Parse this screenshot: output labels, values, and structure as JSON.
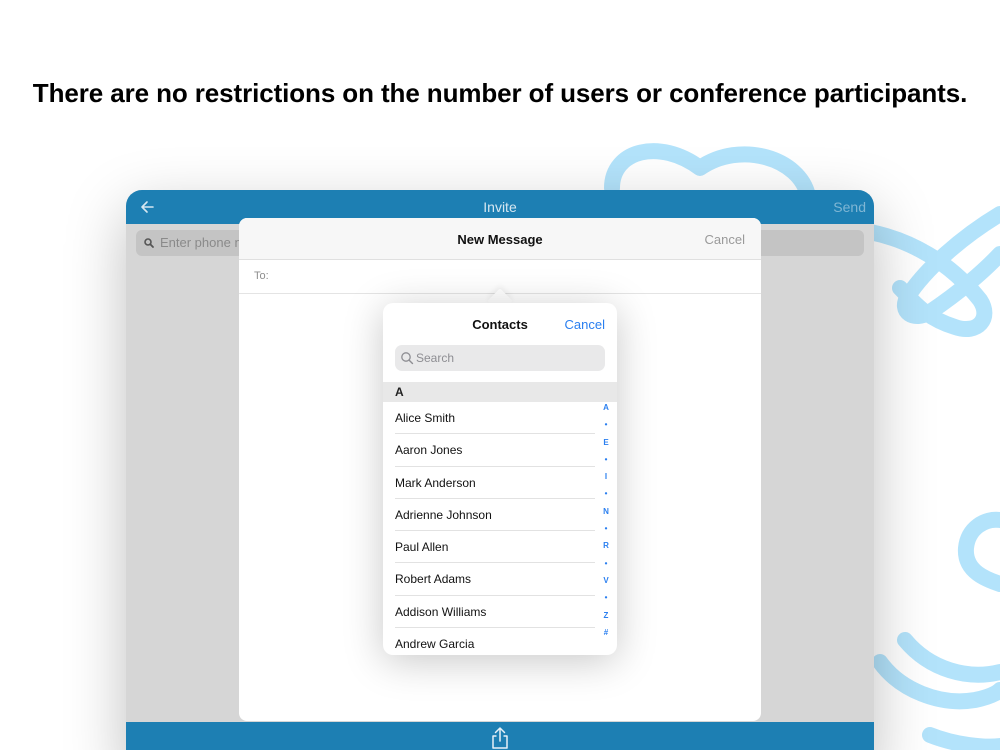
{
  "headline": "There are no restrictions on the number of users or conference participants.",
  "app": {
    "title": "Invite",
    "send_label": "Send",
    "search_placeholder": "Enter phone nu"
  },
  "message_sheet": {
    "title": "New Message",
    "cancel_label": "Cancel",
    "to_label": "To:"
  },
  "contacts_popover": {
    "title": "Contacts",
    "cancel_label": "Cancel",
    "search_placeholder": "Search",
    "section_letter": "A",
    "contacts": [
      "Alice Smith",
      "Aaron Jones",
      "Mark Anderson",
      "Adrienne Johnson",
      "Paul Allen",
      "Robert Adams",
      "Addison Williams",
      "Andrew Garcia"
    ],
    "index": [
      "A",
      "•",
      "E",
      "•",
      "I",
      "•",
      "N",
      "•",
      "R",
      "•",
      "V",
      "•",
      "Z",
      "#"
    ]
  },
  "colors": {
    "brand_blue": "#1d7fb3",
    "link_blue": "#2a7ff0",
    "decor_blue": "#b3e3fb"
  },
  "icons": [
    "back-arrow-icon",
    "search-icon",
    "share-icon"
  ]
}
